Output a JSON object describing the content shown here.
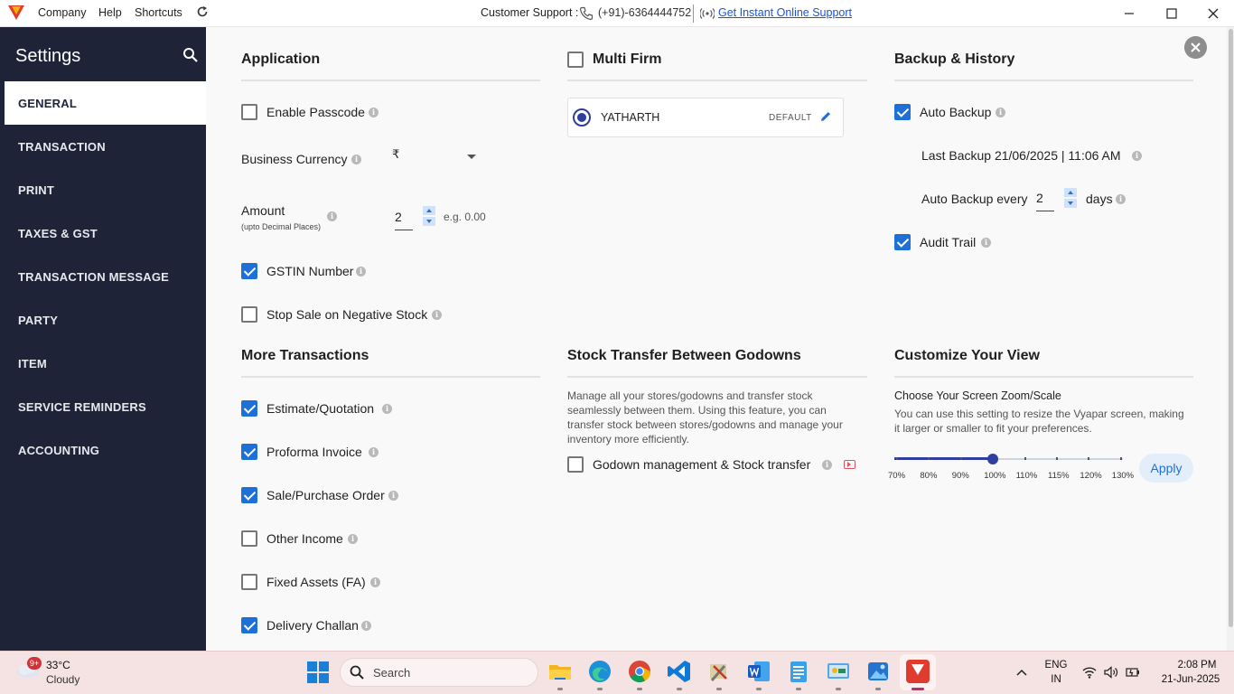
{
  "titlebar": {
    "menu": [
      "Company",
      "Help",
      "Shortcuts"
    ],
    "support_label": "Customer Support :",
    "support_phone": "(+91)-6364444752",
    "support_link": "Get Instant Online Support"
  },
  "sidebar": {
    "title": "Settings",
    "items": [
      "GENERAL",
      "TRANSACTION",
      "PRINT",
      "TAXES & GST",
      "TRANSACTION MESSAGE",
      "PARTY",
      "ITEM",
      "SERVICE REMINDERS",
      "ACCOUNTING"
    ],
    "active_index": 0
  },
  "application": {
    "title": "Application",
    "enable_passcode": {
      "label": "Enable Passcode",
      "checked": false
    },
    "business_currency": {
      "label": "Business Currency",
      "value": "₹"
    },
    "amount": {
      "label": "Amount",
      "sublabel": "(upto Decimal Places)",
      "value": "2",
      "example": "e.g. 0.00"
    },
    "gstin_number": {
      "label": "GSTIN Number",
      "checked": true
    },
    "stop_sale": {
      "label": "Stop Sale on Negative Stock",
      "checked": false
    }
  },
  "multi_firm": {
    "title": "Multi Firm",
    "checked": false,
    "firm": {
      "name": "YATHARTH",
      "tag": "DEFAULT"
    }
  },
  "backup": {
    "title": "Backup & History",
    "auto_backup": {
      "label": "Auto Backup",
      "checked": true
    },
    "last_backup": "Last Backup 21/06/2025 | 11:06 AM",
    "auto_backup_every": {
      "label": "Auto Backup every",
      "value": "2",
      "unit": "days"
    },
    "audit_trail": {
      "label": "Audit Trail",
      "checked": true
    }
  },
  "more_transactions": {
    "title": "More Transactions",
    "items": [
      {
        "label": "Estimate/Quotation",
        "checked": true
      },
      {
        "label": "Proforma Invoice",
        "checked": true
      },
      {
        "label": "Sale/Purchase Order",
        "checked": true
      },
      {
        "label": "Other Income",
        "checked": false
      },
      {
        "label": "Fixed Assets (FA)",
        "checked": false
      },
      {
        "label": "Delivery Challan",
        "checked": true
      }
    ]
  },
  "stock_transfer": {
    "title": "Stock Transfer Between Godowns",
    "description_lines": [
      "Manage all your stores/godowns and transfer stock",
      "seamlessly between them. Using this feature, you can",
      "transfer stock between stores/godowns and manage your",
      "inventory more efficiently."
    ],
    "godown": {
      "label": "Godown management & Stock transfer",
      "checked": false
    }
  },
  "customize_view": {
    "title": "Customize Your View",
    "zoom_title": "Choose Your Screen Zoom/Scale",
    "description_lines": [
      "You can use this setting to resize the Vyapar screen, making",
      "it larger or smaller to fit your preferences."
    ],
    "zoom_levels": [
      "70%",
      "80%",
      "90%",
      "100%",
      "110%",
      "115%",
      "120%",
      "130%"
    ],
    "selected_index": 3,
    "apply_label": "Apply"
  },
  "taskbar": {
    "weather_badge": "9+",
    "temperature": "33°C",
    "condition": "Cloudy",
    "search_placeholder": "Search",
    "language_line1": "ENG",
    "language_line2": "IN",
    "time": "2:08 PM",
    "date": "21-Jun-2025",
    "app_icons": [
      "file-explorer-icon",
      "edge-icon",
      "chrome-icon",
      "vscode-icon",
      "tools-icon",
      "word-icon",
      "notepad-icon",
      "control-panel-icon",
      "photos-icon",
      "vyapar-icon"
    ]
  },
  "colors": {
    "sidebar_bg": "#1f2338",
    "accent_blue": "#1e6fd6",
    "slider": "#2e3f9f",
    "brand_red": "#e03b2f"
  }
}
